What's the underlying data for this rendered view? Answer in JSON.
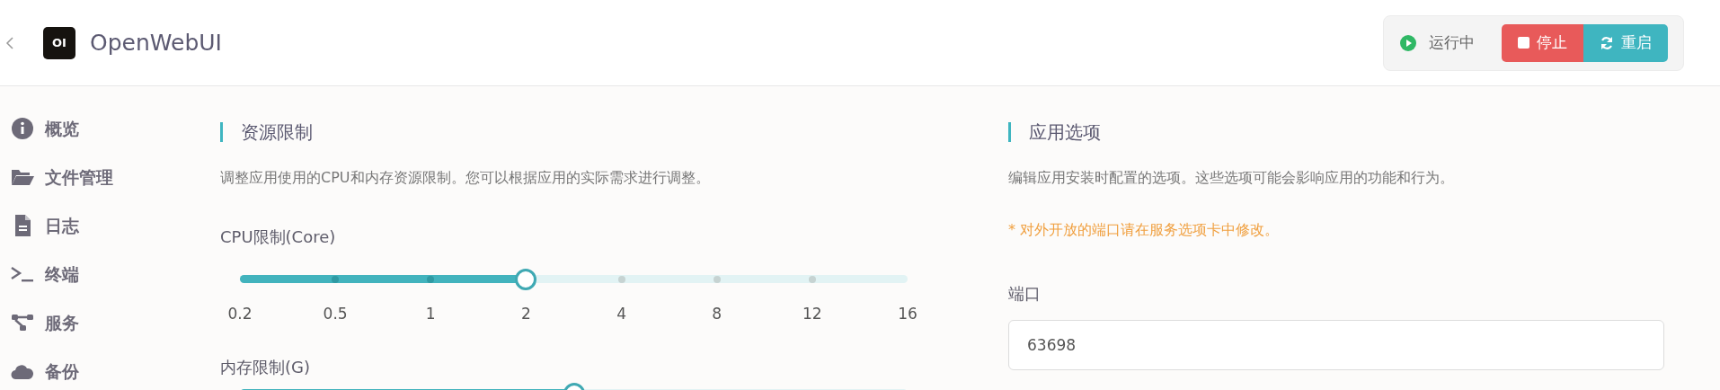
{
  "header": {
    "title": "OpenWebUI",
    "logo_text": "OI",
    "status": "运行中",
    "buttons": [
      {
        "label": "停止",
        "kind": "stop"
      },
      {
        "label": "重启",
        "kind": "restart"
      }
    ]
  },
  "sidebar": {
    "items": [
      {
        "label": "概览"
      },
      {
        "label": "文件管理"
      },
      {
        "label": "日志"
      },
      {
        "label": "终端"
      },
      {
        "label": "服务"
      },
      {
        "label": "备份"
      }
    ]
  },
  "resource_limits": {
    "title": "资源限制",
    "description": "调整应用使用的CPU和内存资源限制。您可以根据应用的实际需求进行调整。",
    "sliders": [
      {
        "label": "CPU限制(Core)",
        "level": 0.4286,
        "ticks": [
          "0.2",
          "0.5",
          "1",
          "2",
          "4",
          "8",
          "12",
          "16"
        ]
      },
      {
        "label": "内存限制(G)",
        "level": 0.5
      }
    ]
  },
  "app_options": {
    "title": "应用选项",
    "description": "编辑应用安装时配置的选项。这些选项可能会影响应用的功能和行为。",
    "note": "* 对外开放的端口请在服务选项卡中修改。",
    "fields": [
      {
        "label": "端口",
        "value": "63698"
      }
    ]
  }
}
